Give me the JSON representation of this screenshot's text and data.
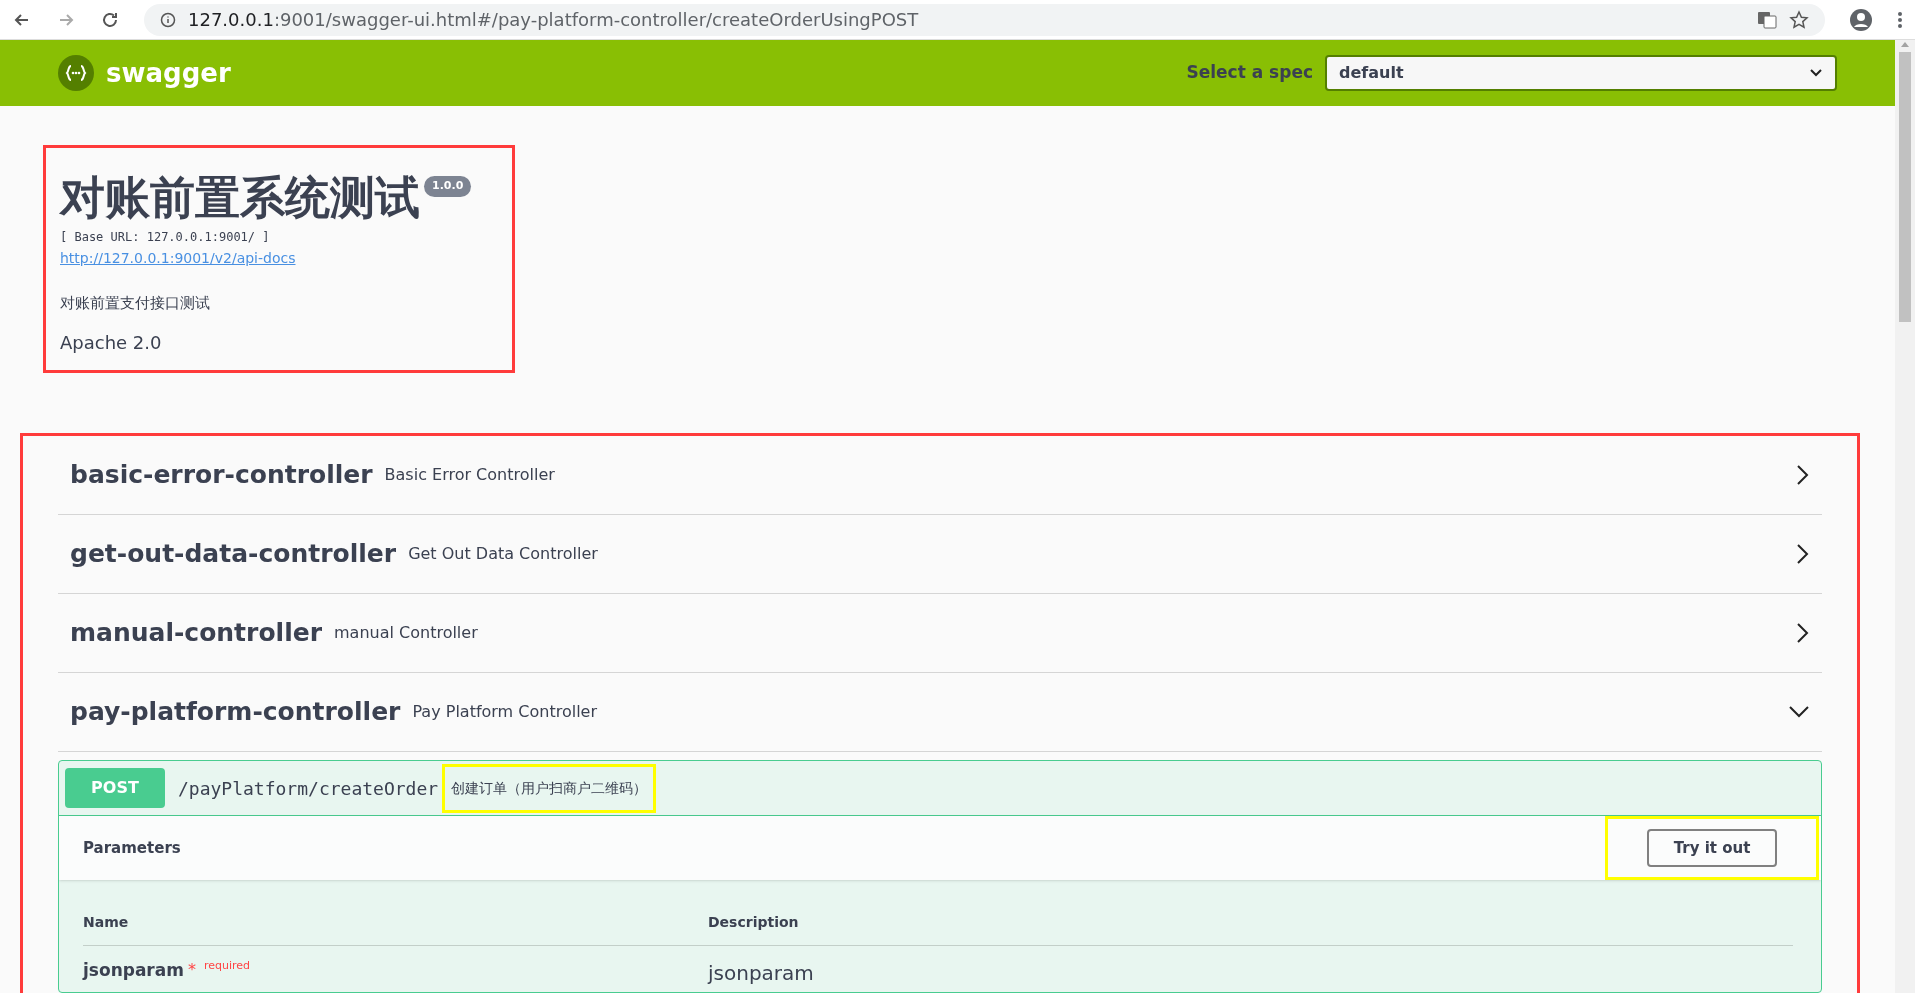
{
  "browser": {
    "url_host": "127.0.0.1",
    "url_rest": ":9001/swagger-ui.html#/pay-platform-controller/createOrderUsingPOST"
  },
  "topbar": {
    "logo_text": "swagger",
    "spec_label": "Select a spec",
    "spec_value": "default"
  },
  "info": {
    "highlighted": true,
    "title": "对账前置系统测试",
    "version": "1.0.0",
    "base_url": "[ Base URL: 127.0.0.1:9001/ ]",
    "docs_link": "http://127.0.0.1:9001/v2/api-docs",
    "description": "对账前置支付接口测试",
    "license": "Apache 2.0"
  },
  "controllers_highlighted": true,
  "controllers": [
    {
      "name": "basic-error-controller",
      "description": "Basic Error Controller",
      "expanded": false
    },
    {
      "name": "get-out-data-controller",
      "description": "Get Out Data Controller",
      "expanded": false
    },
    {
      "name": "manual-controller",
      "description": "manual Controller",
      "expanded": false
    },
    {
      "name": "pay-platform-controller",
      "description": "Pay Platform Controller",
      "expanded": true
    }
  ],
  "operation": {
    "method": "POST",
    "path": "/payPlatform/createOrder",
    "summary": "创建订单（用户扫商户二维码）",
    "summary_highlighted": true,
    "parameters_title": "Parameters",
    "try_button": "Try it out",
    "try_highlighted": true,
    "columns": [
      "Name",
      "Description"
    ],
    "parameters": [
      {
        "name": "jsonparam",
        "required_mark": "*",
        "required_label": "required",
        "description": "jsonparam"
      }
    ]
  }
}
